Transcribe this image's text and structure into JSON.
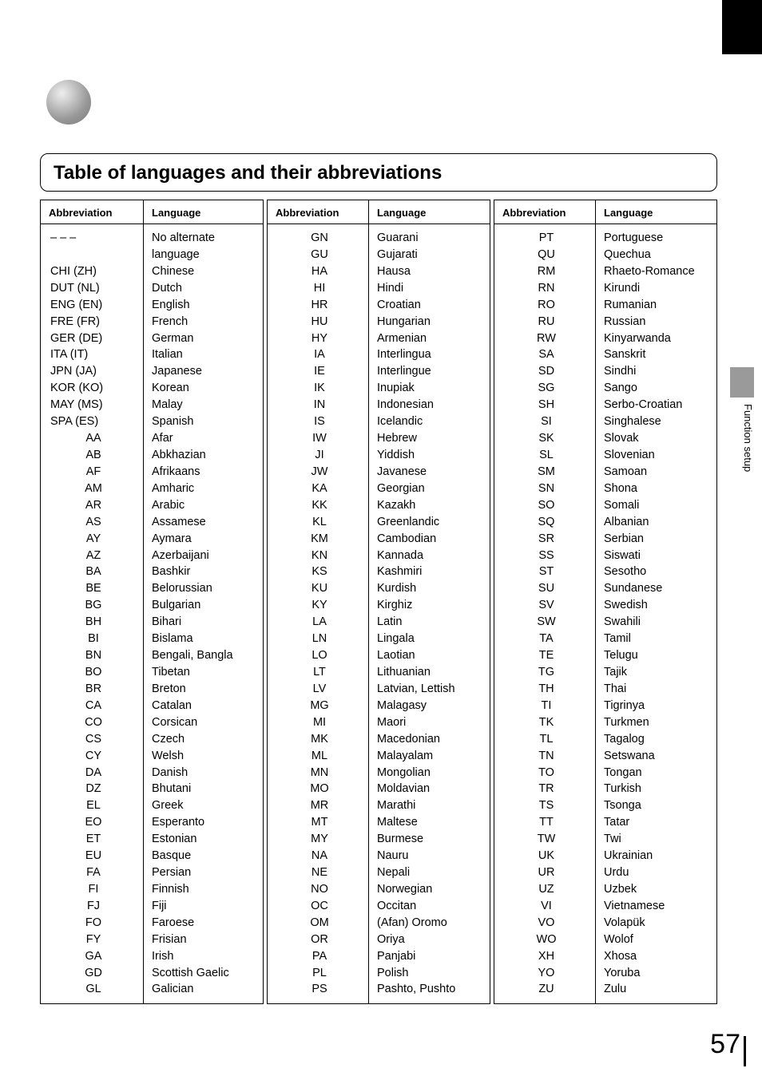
{
  "title": "Table of languages and their abbreviations",
  "headers": {
    "abbr": "Abbreviation",
    "lang": "Language"
  },
  "side_tab": "Function setup",
  "page_number": "57",
  "columns": [
    [
      {
        "abbr": "– – –",
        "lang": "No alternate language",
        "left": true,
        "multi": true
      },
      {
        "abbr": "CHI (ZH)",
        "lang": "Chinese",
        "left": true
      },
      {
        "abbr": "DUT (NL)",
        "lang": "Dutch",
        "left": true
      },
      {
        "abbr": "ENG (EN)",
        "lang": "English",
        "left": true
      },
      {
        "abbr": "FRE (FR)",
        "lang": "French",
        "left": true
      },
      {
        "abbr": "GER (DE)",
        "lang": "German",
        "left": true
      },
      {
        "abbr": "ITA (IT)",
        "lang": "Italian",
        "left": true
      },
      {
        "abbr": "JPN (JA)",
        "lang": "Japanese",
        "left": true
      },
      {
        "abbr": "KOR (KO)",
        "lang": "Korean",
        "left": true
      },
      {
        "abbr": "MAY (MS)",
        "lang": "Malay",
        "left": true
      },
      {
        "abbr": "SPA (ES)",
        "lang": "Spanish",
        "left": true
      },
      {
        "abbr": "AA",
        "lang": "Afar"
      },
      {
        "abbr": "AB",
        "lang": "Abkhazian"
      },
      {
        "abbr": "AF",
        "lang": "Afrikaans"
      },
      {
        "abbr": "AM",
        "lang": "Amharic"
      },
      {
        "abbr": "AR",
        "lang": "Arabic"
      },
      {
        "abbr": "AS",
        "lang": "Assamese"
      },
      {
        "abbr": "AY",
        "lang": "Aymara"
      },
      {
        "abbr": "AZ",
        "lang": "Azerbaijani"
      },
      {
        "abbr": "BA",
        "lang": "Bashkir"
      },
      {
        "abbr": "BE",
        "lang": "Belorussian"
      },
      {
        "abbr": "BG",
        "lang": "Bulgarian"
      },
      {
        "abbr": "BH",
        "lang": "Bihari"
      },
      {
        "abbr": "BI",
        "lang": "Bislama"
      },
      {
        "abbr": "BN",
        "lang": "Bengali, Bangla"
      },
      {
        "abbr": "BO",
        "lang": "Tibetan"
      },
      {
        "abbr": "BR",
        "lang": "Breton"
      },
      {
        "abbr": "CA",
        "lang": "Catalan"
      },
      {
        "abbr": "CO",
        "lang": "Corsican"
      },
      {
        "abbr": "CS",
        "lang": "Czech"
      },
      {
        "abbr": "CY",
        "lang": "Welsh"
      },
      {
        "abbr": "DA",
        "lang": "Danish"
      },
      {
        "abbr": "DZ",
        "lang": "Bhutani"
      },
      {
        "abbr": "EL",
        "lang": "Greek"
      },
      {
        "abbr": "EO",
        "lang": "Esperanto"
      },
      {
        "abbr": "ET",
        "lang": "Estonian"
      },
      {
        "abbr": "EU",
        "lang": "Basque"
      },
      {
        "abbr": "FA",
        "lang": "Persian"
      },
      {
        "abbr": "FI",
        "lang": "Finnish"
      },
      {
        "abbr": "FJ",
        "lang": "Fiji"
      },
      {
        "abbr": "FO",
        "lang": "Faroese"
      },
      {
        "abbr": "FY",
        "lang": "Frisian"
      },
      {
        "abbr": "GA",
        "lang": "Irish"
      },
      {
        "abbr": "GD",
        "lang": "Scottish Gaelic"
      },
      {
        "abbr": "GL",
        "lang": "Galician"
      }
    ],
    [
      {
        "abbr": "GN",
        "lang": "Guarani"
      },
      {
        "abbr": "GU",
        "lang": "Gujarati"
      },
      {
        "abbr": "HA",
        "lang": "Hausa"
      },
      {
        "abbr": "HI",
        "lang": "Hindi"
      },
      {
        "abbr": "HR",
        "lang": "Croatian"
      },
      {
        "abbr": "HU",
        "lang": "Hungarian"
      },
      {
        "abbr": "HY",
        "lang": "Armenian"
      },
      {
        "abbr": "IA",
        "lang": "Interlingua"
      },
      {
        "abbr": "IE",
        "lang": "Interlingue"
      },
      {
        "abbr": "IK",
        "lang": "Inupiak"
      },
      {
        "abbr": "IN",
        "lang": "Indonesian"
      },
      {
        "abbr": "IS",
        "lang": "Icelandic"
      },
      {
        "abbr": "IW",
        "lang": "Hebrew"
      },
      {
        "abbr": "JI",
        "lang": "Yiddish"
      },
      {
        "abbr": "JW",
        "lang": "Javanese"
      },
      {
        "abbr": "KA",
        "lang": "Georgian"
      },
      {
        "abbr": "KK",
        "lang": "Kazakh"
      },
      {
        "abbr": "KL",
        "lang": "Greenlandic"
      },
      {
        "abbr": "KM",
        "lang": "Cambodian"
      },
      {
        "abbr": "KN",
        "lang": "Kannada"
      },
      {
        "abbr": "KS",
        "lang": "Kashmiri"
      },
      {
        "abbr": "KU",
        "lang": "Kurdish"
      },
      {
        "abbr": "KY",
        "lang": "Kirghiz"
      },
      {
        "abbr": "LA",
        "lang": "Latin"
      },
      {
        "abbr": "LN",
        "lang": "Lingala"
      },
      {
        "abbr": "LO",
        "lang": "Laotian"
      },
      {
        "abbr": "LT",
        "lang": "Lithuanian"
      },
      {
        "abbr": "LV",
        "lang": "Latvian, Lettish"
      },
      {
        "abbr": "MG",
        "lang": "Malagasy"
      },
      {
        "abbr": "MI",
        "lang": "Maori"
      },
      {
        "abbr": "MK",
        "lang": "Macedonian"
      },
      {
        "abbr": "ML",
        "lang": "Malayalam"
      },
      {
        "abbr": "MN",
        "lang": "Mongolian"
      },
      {
        "abbr": "MO",
        "lang": "Moldavian"
      },
      {
        "abbr": "MR",
        "lang": "Marathi"
      },
      {
        "abbr": "MT",
        "lang": "Maltese"
      },
      {
        "abbr": "MY",
        "lang": "Burmese"
      },
      {
        "abbr": "NA",
        "lang": "Nauru"
      },
      {
        "abbr": "NE",
        "lang": "Nepali"
      },
      {
        "abbr": "NO",
        "lang": "Norwegian"
      },
      {
        "abbr": "OC",
        "lang": "Occitan"
      },
      {
        "abbr": "OM",
        "lang": "(Afan) Oromo"
      },
      {
        "abbr": "OR",
        "lang": "Oriya"
      },
      {
        "abbr": "PA",
        "lang": "Panjabi"
      },
      {
        "abbr": "PL",
        "lang": "Polish"
      },
      {
        "abbr": "PS",
        "lang": "Pashto, Pushto"
      }
    ],
    [
      {
        "abbr": "PT",
        "lang": "Portuguese"
      },
      {
        "abbr": "QU",
        "lang": "Quechua"
      },
      {
        "abbr": "RM",
        "lang": "Rhaeto-Romance"
      },
      {
        "abbr": "RN",
        "lang": "Kirundi"
      },
      {
        "abbr": "RO",
        "lang": "Rumanian"
      },
      {
        "abbr": "RU",
        "lang": "Russian"
      },
      {
        "abbr": "RW",
        "lang": "Kinyarwanda"
      },
      {
        "abbr": "SA",
        "lang": "Sanskrit"
      },
      {
        "abbr": "SD",
        "lang": "Sindhi"
      },
      {
        "abbr": "SG",
        "lang": "Sango"
      },
      {
        "abbr": "SH",
        "lang": "Serbo-Croatian"
      },
      {
        "abbr": "SI",
        "lang": "Singhalese"
      },
      {
        "abbr": "SK",
        "lang": "Slovak"
      },
      {
        "abbr": "SL",
        "lang": "Slovenian"
      },
      {
        "abbr": "SM",
        "lang": "Samoan"
      },
      {
        "abbr": "SN",
        "lang": "Shona"
      },
      {
        "abbr": "SO",
        "lang": "Somali"
      },
      {
        "abbr": "SQ",
        "lang": "Albanian"
      },
      {
        "abbr": "SR",
        "lang": "Serbian"
      },
      {
        "abbr": "SS",
        "lang": "Siswati"
      },
      {
        "abbr": "ST",
        "lang": "Sesotho"
      },
      {
        "abbr": "SU",
        "lang": "Sundanese"
      },
      {
        "abbr": "SV",
        "lang": "Swedish"
      },
      {
        "abbr": "SW",
        "lang": "Swahili"
      },
      {
        "abbr": "TA",
        "lang": "Tamil"
      },
      {
        "abbr": "TE",
        "lang": "Telugu"
      },
      {
        "abbr": "TG",
        "lang": "Tajik"
      },
      {
        "abbr": "TH",
        "lang": "Thai"
      },
      {
        "abbr": "TI",
        "lang": "Tigrinya"
      },
      {
        "abbr": "TK",
        "lang": "Turkmen"
      },
      {
        "abbr": "TL",
        "lang": "Tagalog"
      },
      {
        "abbr": "TN",
        "lang": "Setswana"
      },
      {
        "abbr": "TO",
        "lang": "Tongan"
      },
      {
        "abbr": "TR",
        "lang": "Turkish"
      },
      {
        "abbr": "TS",
        "lang": "Tsonga"
      },
      {
        "abbr": "TT",
        "lang": "Tatar"
      },
      {
        "abbr": "TW",
        "lang": "Twi"
      },
      {
        "abbr": "UK",
        "lang": "Ukrainian"
      },
      {
        "abbr": "UR",
        "lang": "Urdu"
      },
      {
        "abbr": "UZ",
        "lang": "Uzbek"
      },
      {
        "abbr": "VI",
        "lang": "Vietnamese"
      },
      {
        "abbr": "VO",
        "lang": "Volapük"
      },
      {
        "abbr": "WO",
        "lang": "Wolof"
      },
      {
        "abbr": "XH",
        "lang": "Xhosa"
      },
      {
        "abbr": "YO",
        "lang": "Yoruba"
      },
      {
        "abbr": "ZU",
        "lang": "Zulu"
      }
    ]
  ]
}
